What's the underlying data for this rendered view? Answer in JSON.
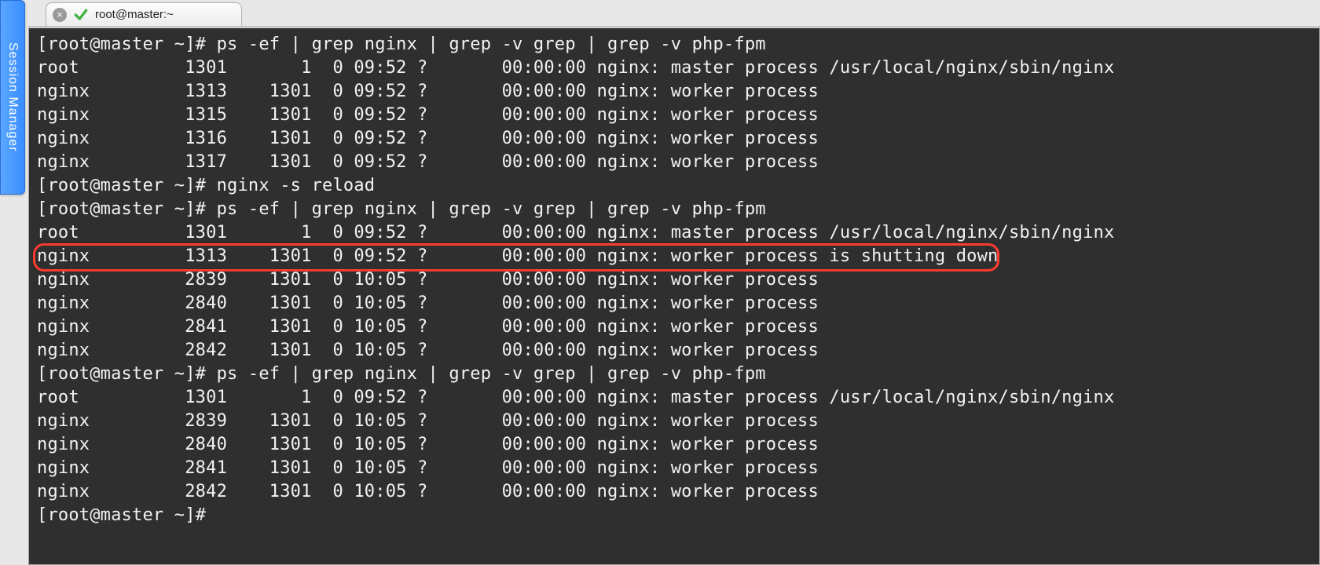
{
  "session_manager_label": "Session Manager",
  "tab": {
    "title": "root@master:~"
  },
  "terminal": {
    "prompt": "[root@master ~]# ",
    "commands": {
      "ps": "ps -ef | grep nginx | grep -v grep | grep -v php-fpm",
      "reload": "nginx -s reload"
    },
    "cols": {
      "uid_w": 12,
      "pid_w": 6,
      "ppid_w": 8,
      "c_w": 2,
      "stime_w": 6,
      "tty_w": 8,
      "time_w": 9
    },
    "blocks": [
      {
        "type": "cmd",
        "key": "ps"
      },
      {
        "type": "rows",
        "rows": [
          {
            "uid": "root",
            "pid": "1301",
            "ppid": "1",
            "c": "0",
            "stime": "09:52",
            "tty": "?",
            "time": "00:00:00",
            "cmd": "nginx: master process /usr/local/nginx/sbin/nginx"
          },
          {
            "uid": "nginx",
            "pid": "1313",
            "ppid": "1301",
            "c": "0",
            "stime": "09:52",
            "tty": "?",
            "time": "00:00:00",
            "cmd": "nginx: worker process"
          },
          {
            "uid": "nginx",
            "pid": "1315",
            "ppid": "1301",
            "c": "0",
            "stime": "09:52",
            "tty": "?",
            "time": "00:00:00",
            "cmd": "nginx: worker process"
          },
          {
            "uid": "nginx",
            "pid": "1316",
            "ppid": "1301",
            "c": "0",
            "stime": "09:52",
            "tty": "?",
            "time": "00:00:00",
            "cmd": "nginx: worker process"
          },
          {
            "uid": "nginx",
            "pid": "1317",
            "ppid": "1301",
            "c": "0",
            "stime": "09:52",
            "tty": "?",
            "time": "00:00:00",
            "cmd": "nginx: worker process"
          }
        ]
      },
      {
        "type": "cmd",
        "key": "reload"
      },
      {
        "type": "cmd",
        "key": "ps"
      },
      {
        "type": "rows",
        "rows": [
          {
            "uid": "root",
            "pid": "1301",
            "ppid": "1",
            "c": "0",
            "stime": "09:52",
            "tty": "?",
            "time": "00:00:00",
            "cmd": "nginx: master process /usr/local/nginx/sbin/nginx"
          },
          {
            "uid": "nginx",
            "pid": "1313",
            "ppid": "1301",
            "c": "0",
            "stime": "09:52",
            "tty": "?",
            "time": "00:00:00",
            "cmd": "nginx: worker process is shutting down",
            "highlight": true
          },
          {
            "uid": "nginx",
            "pid": "2839",
            "ppid": "1301",
            "c": "0",
            "stime": "10:05",
            "tty": "?",
            "time": "00:00:00",
            "cmd": "nginx: worker process"
          },
          {
            "uid": "nginx",
            "pid": "2840",
            "ppid": "1301",
            "c": "0",
            "stime": "10:05",
            "tty": "?",
            "time": "00:00:00",
            "cmd": "nginx: worker process"
          },
          {
            "uid": "nginx",
            "pid": "2841",
            "ppid": "1301",
            "c": "0",
            "stime": "10:05",
            "tty": "?",
            "time": "00:00:00",
            "cmd": "nginx: worker process"
          },
          {
            "uid": "nginx",
            "pid": "2842",
            "ppid": "1301",
            "c": "0",
            "stime": "10:05",
            "tty": "?",
            "time": "00:00:00",
            "cmd": "nginx: worker process"
          }
        ]
      },
      {
        "type": "cmd",
        "key": "ps"
      },
      {
        "type": "rows",
        "rows": [
          {
            "uid": "root",
            "pid": "1301",
            "ppid": "1",
            "c": "0",
            "stime": "09:52",
            "tty": "?",
            "time": "00:00:00",
            "cmd": "nginx: master process /usr/local/nginx/sbin/nginx"
          },
          {
            "uid": "nginx",
            "pid": "2839",
            "ppid": "1301",
            "c": "0",
            "stime": "10:05",
            "tty": "?",
            "time": "00:00:00",
            "cmd": "nginx: worker process"
          },
          {
            "uid": "nginx",
            "pid": "2840",
            "ppid": "1301",
            "c": "0",
            "stime": "10:05",
            "tty": "?",
            "time": "00:00:00",
            "cmd": "nginx: worker process"
          },
          {
            "uid": "nginx",
            "pid": "2841",
            "ppid": "1301",
            "c": "0",
            "stime": "10:05",
            "tty": "?",
            "time": "00:00:00",
            "cmd": "nginx: worker process"
          },
          {
            "uid": "nginx",
            "pid": "2842",
            "ppid": "1301",
            "c": "0",
            "stime": "10:05",
            "tty": "?",
            "time": "00:00:00",
            "cmd": "nginx: worker process"
          }
        ]
      },
      {
        "type": "prompt_only"
      }
    ]
  }
}
